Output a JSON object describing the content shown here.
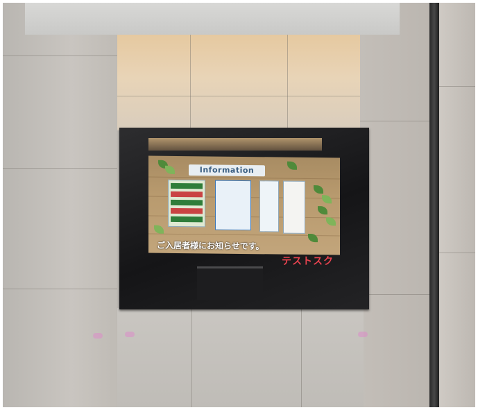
{
  "screen": {
    "banner_text": "Information",
    "notice_text": "ご入居者様にお知らせです。"
  },
  "overlay": {
    "watermark_text": "テストスク"
  }
}
